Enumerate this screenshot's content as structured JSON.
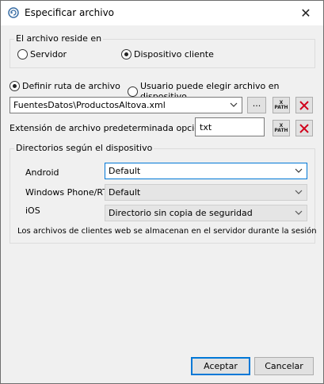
{
  "window": {
    "title": "Especificar archivo",
    "close_glyph": "✕"
  },
  "location_group": {
    "legend": "El archivo reside en",
    "options": [
      {
        "label": "Servidor",
        "selected": false
      },
      {
        "label": "Dispositivo cliente",
        "selected": true
      }
    ]
  },
  "path_mode": {
    "options": [
      {
        "label": "Definir ruta de archivo",
        "selected": true
      },
      {
        "label": "Usuario puede elegir archivo en dispositivo",
        "selected": false
      }
    ]
  },
  "file_path": {
    "value": "FuentesDatos\\ProductosAltova.xml",
    "browse_label": "...",
    "xpath_label_top": "X",
    "xpath_label_bottom": "PATH"
  },
  "extension": {
    "label": "Extensión de archivo predeterminada opcional",
    "value": "txt"
  },
  "device_dirs": {
    "legend": "Directorios según el dispositivo",
    "rows": [
      {
        "label": "Android",
        "value": "Default",
        "enabled": true
      },
      {
        "label": "Windows Phone/RT",
        "value": "Default",
        "enabled": false
      },
      {
        "label": "iOS",
        "value": "Directorio sin copia de seguridad",
        "enabled": false
      }
    ],
    "note": "Los archivos de clientes web se almacenan en el servidor durante la sesión"
  },
  "buttons": {
    "accept": "Aceptar",
    "cancel": "Cancelar"
  },
  "colors": {
    "accent": "#0078d7",
    "delete_red": "#d0021b"
  }
}
